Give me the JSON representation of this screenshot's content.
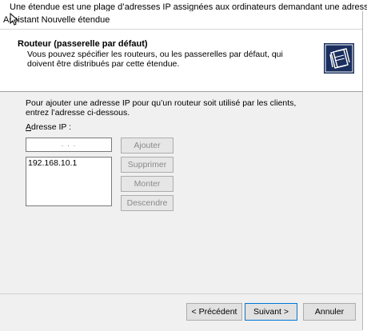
{
  "background_text": "Une étendue est une plage d’adresses IP assignées aux ordinateurs demandant une adresse IP d",
  "window": {
    "title": "Assistant Nouvelle étendue"
  },
  "header": {
    "title": "Routeur (passerelle par défaut)",
    "subtitle": "Vous pouvez spécifier les routeurs, ou les passerelles par défaut, qui doivent être distribués par cette étendue.",
    "icon": "folder-stack-icon"
  },
  "main": {
    "intro": "Pour ajouter une adresse IP pour qu’un routeur soit utilisé par les clients, entrez l’adresse ci-dessous.",
    "ip_label": "Adresse IP :",
    "ip_placeholder": ". . .",
    "routers": [
      "192.168.10.1"
    ],
    "buttons": {
      "add": "Ajouter",
      "remove": "Supprimer",
      "up": "Monter",
      "down": "Descendre"
    }
  },
  "footer": {
    "back": "< Précédent",
    "next": "Suivant >",
    "cancel": "Annuler"
  },
  "colors": {
    "window_bg": "#f0f0f0",
    "header_bg": "#ffffff",
    "default_button_border": "#0078d7",
    "disabled_text": "#8a8a8a"
  }
}
